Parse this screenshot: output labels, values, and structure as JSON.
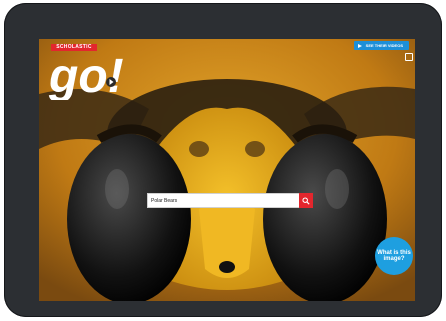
{
  "header": {
    "brand_label": "SCHOLASTIC",
    "logo_text": "go!",
    "top_button_label": "SEE THEIR VIDEOS"
  },
  "search": {
    "value": "Polar Bears"
  },
  "hero": {
    "bubble_text": "What is this image?"
  },
  "colors": {
    "brand_red": "#e3262d",
    "accent_blue": "#1e9fe0",
    "bezel": "#2c2f33"
  },
  "icons": {
    "search": "search-icon",
    "play": "play-icon"
  }
}
